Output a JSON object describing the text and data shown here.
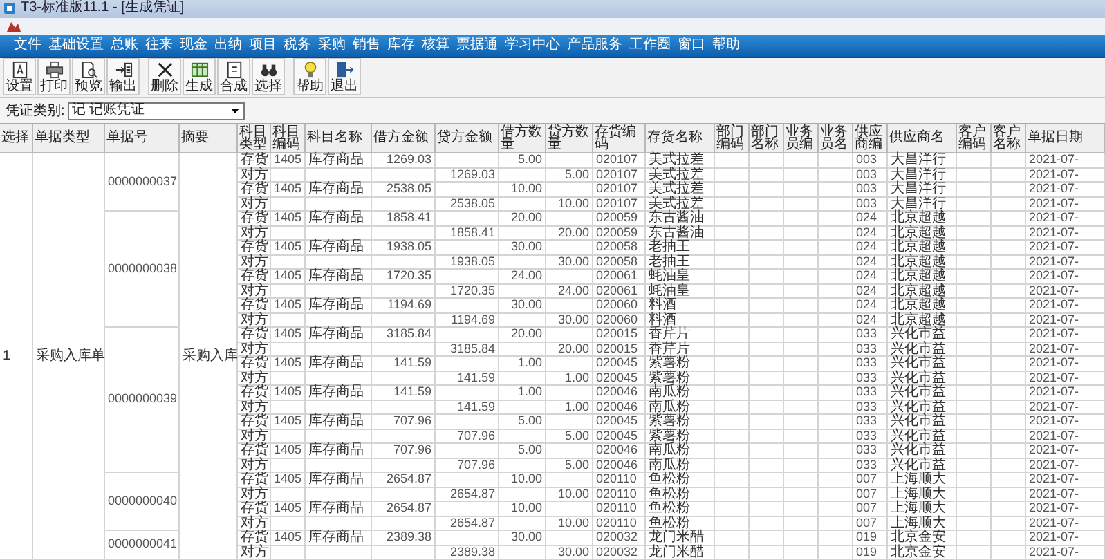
{
  "window": {
    "title": "T3-标准版11.1 - [生成凭证]"
  },
  "menu": [
    "文件",
    "基础设置",
    "总账",
    "往来",
    "现金",
    "出纳",
    "项目",
    "税务",
    "采购",
    "销售",
    "库存",
    "核算",
    "票据通",
    "学习中心",
    "产品服务",
    "工作圈",
    "窗口",
    "帮助"
  ],
  "toolbar_groups": [
    {
      "buttons": [
        {
          "label": "设置",
          "kind": "setup"
        },
        {
          "label": "打印",
          "kind": "print"
        },
        {
          "label": "预览",
          "kind": "preview"
        },
        {
          "label": "输出",
          "kind": "export"
        }
      ]
    },
    {
      "buttons": [
        {
          "label": "删除",
          "kind": "delete"
        },
        {
          "label": "生成",
          "kind": "generate"
        },
        {
          "label": "合成",
          "kind": "merge"
        },
        {
          "label": "选择",
          "kind": "select"
        }
      ]
    },
    {
      "buttons": [
        {
          "label": "帮助",
          "kind": "help"
        },
        {
          "label": "退出",
          "kind": "exit"
        }
      ]
    }
  ],
  "voucher_type": {
    "label": "凭证类别:",
    "value": "记 记账凭证"
  },
  "table": {
    "columns": [
      "选择",
      "单据类型",
      "单据号",
      "摘要",
      "科目类型",
      "科目编码",
      "科目名称",
      "借方金额",
      "贷方金额",
      "借方数量",
      "贷方数量",
      "存货编码",
      "存货名称",
      "部门编码",
      "部门名称",
      "业务员编",
      "业务员名",
      "供应商编",
      "供应商名",
      "客户编码",
      "客户名称",
      "单据日期"
    ],
    "select": "1",
    "bill_type": "采购入库单",
    "summary": "采购入库",
    "bills": [
      {
        "number": "0000000037",
        "rows": [
          {
            "kind": "debit",
            "subject_type": "存货",
            "subject_code": "1405",
            "subject_name": "库存商品",
            "amount": "1269.03",
            "qty": "5.00",
            "inventory_code": "020107",
            "inventory_name": "美式拉差",
            "supplier_code": "003",
            "supplier_name": "大昌洋行",
            "date": "2021-07-"
          },
          {
            "kind": "credit",
            "subject_type": "对方",
            "amount": "1269.03",
            "qty": "5.00",
            "inventory_code": "020107",
            "inventory_name": "美式拉差",
            "supplier_code": "003",
            "supplier_name": "大昌洋行",
            "date": "2021-07-"
          },
          {
            "kind": "debit",
            "subject_type": "存货",
            "subject_code": "1405",
            "subject_name": "库存商品",
            "amount": "2538.05",
            "qty": "10.00",
            "inventory_code": "020107",
            "inventory_name": "美式拉差",
            "supplier_code": "003",
            "supplier_name": "大昌洋行",
            "date": "2021-07-"
          },
          {
            "kind": "credit",
            "subject_type": "对方",
            "amount": "2538.05",
            "qty": "10.00",
            "inventory_code": "020107",
            "inventory_name": "美式拉差",
            "supplier_code": "003",
            "supplier_name": "大昌洋行",
            "date": "2021-07-"
          }
        ]
      },
      {
        "number": "0000000038",
        "rows": [
          {
            "kind": "debit",
            "subject_type": "存货",
            "subject_code": "1405",
            "subject_name": "库存商品",
            "amount": "1858.41",
            "qty": "20.00",
            "inventory_code": "020059",
            "inventory_name": "东古酱油",
            "supplier_code": "024",
            "supplier_name": "北京超越",
            "date": "2021-07-"
          },
          {
            "kind": "credit",
            "subject_type": "对方",
            "amount": "1858.41",
            "qty": "20.00",
            "inventory_code": "020059",
            "inventory_name": "东古酱油",
            "supplier_code": "024",
            "supplier_name": "北京超越",
            "date": "2021-07-"
          },
          {
            "kind": "debit",
            "subject_type": "存货",
            "subject_code": "1405",
            "subject_name": "库存商品",
            "amount": "1938.05",
            "qty": "30.00",
            "inventory_code": "020058",
            "inventory_name": "老抽王",
            "supplier_code": "024",
            "supplier_name": "北京超越",
            "date": "2021-07-"
          },
          {
            "kind": "credit",
            "subject_type": "对方",
            "amount": "1938.05",
            "qty": "30.00",
            "inventory_code": "020058",
            "inventory_name": "老抽王",
            "supplier_code": "024",
            "supplier_name": "北京超越",
            "date": "2021-07-"
          },
          {
            "kind": "debit",
            "subject_type": "存货",
            "subject_code": "1405",
            "subject_name": "库存商品",
            "amount": "1720.35",
            "qty": "24.00",
            "inventory_code": "020061",
            "inventory_name": "蚝油皇",
            "supplier_code": "024",
            "supplier_name": "北京超越",
            "date": "2021-07-"
          },
          {
            "kind": "credit",
            "subject_type": "对方",
            "amount": "1720.35",
            "qty": "24.00",
            "inventory_code": "020061",
            "inventory_name": "蚝油皇",
            "supplier_code": "024",
            "supplier_name": "北京超越",
            "date": "2021-07-"
          },
          {
            "kind": "debit",
            "subject_type": "存货",
            "subject_code": "1405",
            "subject_name": "库存商品",
            "amount": "1194.69",
            "qty": "30.00",
            "inventory_code": "020060",
            "inventory_name": "料酒",
            "supplier_code": "024",
            "supplier_name": "北京超越",
            "date": "2021-07-"
          },
          {
            "kind": "credit",
            "subject_type": "对方",
            "amount": "1194.69",
            "qty": "30.00",
            "inventory_code": "020060",
            "inventory_name": "料酒",
            "supplier_code": "024",
            "supplier_name": "北京超越",
            "date": "2021-07-"
          }
        ]
      },
      {
        "number": "0000000039",
        "rows": [
          {
            "kind": "debit",
            "subject_type": "存货",
            "subject_code": "1405",
            "subject_name": "库存商品",
            "amount": "3185.84",
            "qty": "20.00",
            "inventory_code": "020015",
            "inventory_name": "香芹片",
            "supplier_code": "033",
            "supplier_name": "兴化市益",
            "date": "2021-07-"
          },
          {
            "kind": "credit",
            "subject_type": "对方",
            "amount": "3185.84",
            "qty": "20.00",
            "inventory_code": "020015",
            "inventory_name": "香芹片",
            "supplier_code": "033",
            "supplier_name": "兴化市益",
            "date": "2021-07-"
          },
          {
            "kind": "debit",
            "subject_type": "存货",
            "subject_code": "1405",
            "subject_name": "库存商品",
            "amount": "141.59",
            "qty": "1.00",
            "inventory_code": "020045",
            "inventory_name": "紫薯粉",
            "supplier_code": "033",
            "supplier_name": "兴化市益",
            "date": "2021-07-"
          },
          {
            "kind": "credit",
            "subject_type": "对方",
            "amount": "141.59",
            "qty": "1.00",
            "inventory_code": "020045",
            "inventory_name": "紫薯粉",
            "supplier_code": "033",
            "supplier_name": "兴化市益",
            "date": "2021-07-"
          },
          {
            "kind": "debit",
            "subject_type": "存货",
            "subject_code": "1405",
            "subject_name": "库存商品",
            "amount": "141.59",
            "qty": "1.00",
            "inventory_code": "020046",
            "inventory_name": "南瓜粉",
            "supplier_code": "033",
            "supplier_name": "兴化市益",
            "date": "2021-07-"
          },
          {
            "kind": "credit",
            "subject_type": "对方",
            "amount": "141.59",
            "qty": "1.00",
            "inventory_code": "020046",
            "inventory_name": "南瓜粉",
            "supplier_code": "033",
            "supplier_name": "兴化市益",
            "date": "2021-07-"
          },
          {
            "kind": "debit",
            "subject_type": "存货",
            "subject_code": "1405",
            "subject_name": "库存商品",
            "amount": "707.96",
            "qty": "5.00",
            "inventory_code": "020045",
            "inventory_name": "紫薯粉",
            "supplier_code": "033",
            "supplier_name": "兴化市益",
            "date": "2021-07-"
          },
          {
            "kind": "credit",
            "subject_type": "对方",
            "amount": "707.96",
            "qty": "5.00",
            "inventory_code": "020045",
            "inventory_name": "紫薯粉",
            "supplier_code": "033",
            "supplier_name": "兴化市益",
            "date": "2021-07-"
          },
          {
            "kind": "debit",
            "subject_type": "存货",
            "subject_code": "1405",
            "subject_name": "库存商品",
            "amount": "707.96",
            "qty": "5.00",
            "inventory_code": "020046",
            "inventory_name": "南瓜粉",
            "supplier_code": "033",
            "supplier_name": "兴化市益",
            "date": "2021-07-"
          },
          {
            "kind": "credit",
            "subject_type": "对方",
            "amount": "707.96",
            "qty": "5.00",
            "inventory_code": "020046",
            "inventory_name": "南瓜粉",
            "supplier_code": "033",
            "supplier_name": "兴化市益",
            "date": "2021-07-"
          }
        ]
      },
      {
        "number": "0000000040",
        "rows": [
          {
            "kind": "debit",
            "subject_type": "存货",
            "subject_code": "1405",
            "subject_name": "库存商品",
            "amount": "2654.87",
            "qty": "10.00",
            "inventory_code": "020110",
            "inventory_name": "鱼松粉",
            "supplier_code": "007",
            "supplier_name": "上海顺大",
            "date": "2021-07-"
          },
          {
            "kind": "credit",
            "subject_type": "对方",
            "amount": "2654.87",
            "qty": "10.00",
            "inventory_code": "020110",
            "inventory_name": "鱼松粉",
            "supplier_code": "007",
            "supplier_name": "上海顺大",
            "date": "2021-07-"
          },
          {
            "kind": "debit",
            "subject_type": "存货",
            "subject_code": "1405",
            "subject_name": "库存商品",
            "amount": "2654.87",
            "qty": "10.00",
            "inventory_code": "020110",
            "inventory_name": "鱼松粉",
            "supplier_code": "007",
            "supplier_name": "上海顺大",
            "date": "2021-07-"
          },
          {
            "kind": "credit",
            "subject_type": "对方",
            "amount": "2654.87",
            "qty": "10.00",
            "inventory_code": "020110",
            "inventory_name": "鱼松粉",
            "supplier_code": "007",
            "supplier_name": "上海顺大",
            "date": "2021-07-"
          }
        ]
      },
      {
        "number": "0000000041",
        "rows": [
          {
            "kind": "debit",
            "subject_type": "存货",
            "subject_code": "1405",
            "subject_name": "库存商品",
            "amount": "2389.38",
            "qty": "30.00",
            "inventory_code": "020032",
            "inventory_name": "龙门米醋",
            "supplier_code": "019",
            "supplier_name": "北京金安",
            "date": "2021-07-"
          },
          {
            "kind": "credit",
            "subject_type": "对方",
            "amount": "2389.38",
            "qty": "30.00",
            "inventory_code": "020032",
            "inventory_name": "龙门米醋",
            "supplier_code": "019",
            "supplier_name": "北京金安",
            "date": "2021-07-"
          }
        ]
      }
    ]
  }
}
